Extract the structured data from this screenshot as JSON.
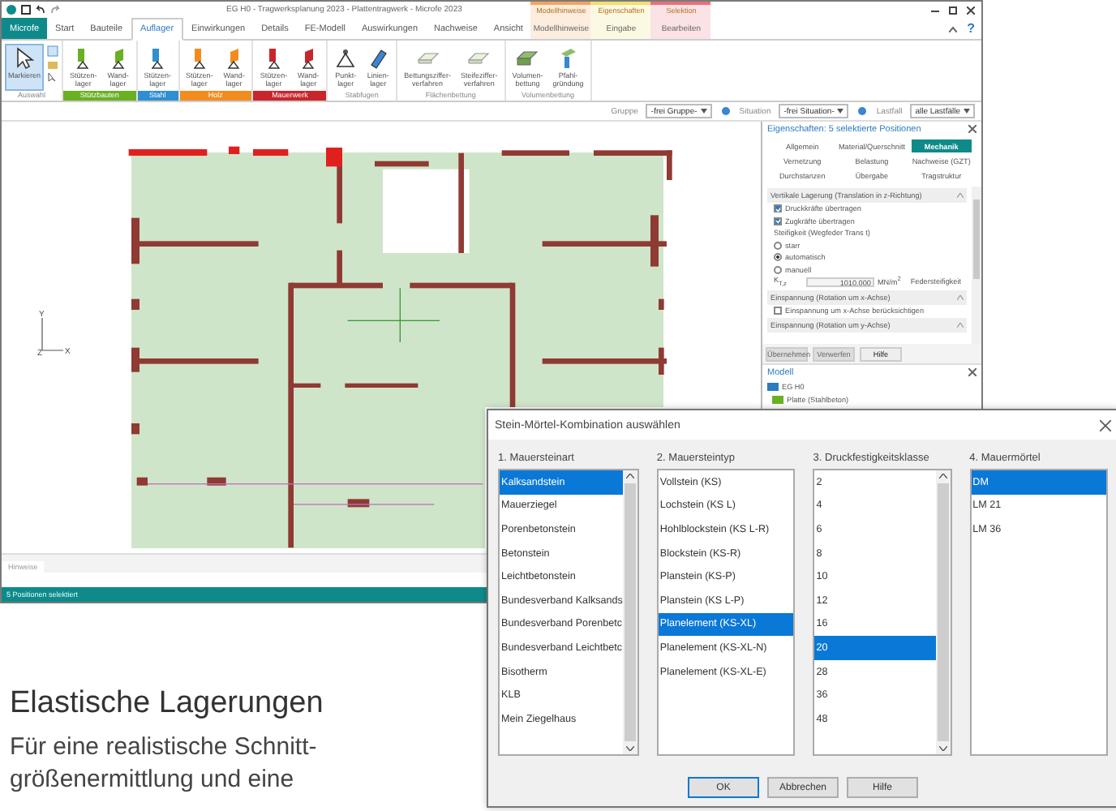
{
  "window": {
    "title": "EG H0 - Tragwerksplanung 2023 - Plattentragwerk - Microfe 2023"
  },
  "ribbon_tabs": [
    {
      "label": "Microfe",
      "kind": "app",
      "selected": false
    },
    {
      "label": "Start",
      "kind": "tab",
      "selected": false
    },
    {
      "label": "Bauteile",
      "kind": "tab",
      "selected": false
    },
    {
      "label": "Auflager",
      "kind": "tab",
      "selected": true
    },
    {
      "label": "Einwirkungen",
      "kind": "tab",
      "selected": false
    },
    {
      "label": "Details",
      "kind": "tab",
      "selected": false
    },
    {
      "label": "FE-Modell",
      "kind": "tab",
      "selected": false
    },
    {
      "label": "Auswirkungen",
      "kind": "tab",
      "selected": false
    },
    {
      "label": "Nachweise",
      "kind": "tab",
      "selected": false
    },
    {
      "label": "Ansicht",
      "kind": "tab",
      "selected": false
    }
  ],
  "context_tabs": [
    {
      "group": "Modellhinweise",
      "label": "Modellhinweise",
      "color": "#f4a460"
    },
    {
      "group": "Eigenschaften",
      "label": "Eingabe",
      "color": "#f2df6e"
    },
    {
      "group": "Selektion",
      "label": "Bearbeiten",
      "color": "#e8707c"
    }
  ],
  "help": "?",
  "ribbon_groups": [
    {
      "label": "Auswahl",
      "buttons": [
        {
          "label": "Markieren",
          "kind": "pointer",
          "selected": true
        }
      ]
    },
    {
      "label": "Stützbauten",
      "color": "#6ab023",
      "buttons": [
        {
          "label": "Stützen-\nlager",
          "kind": "column",
          "selected": false
        },
        {
          "label": "Wand-\nlager",
          "kind": "wall",
          "selected": false
        }
      ]
    },
    {
      "label": "Stahl",
      "color": "#2f8fd0",
      "buttons": [
        {
          "label": "Stützen-\nlager",
          "kind": "column",
          "selected": false
        }
      ]
    },
    {
      "label": "Holz",
      "color": "#f28c1e",
      "buttons": [
        {
          "label": "Stützen-\nlager",
          "kind": "column",
          "selected": false
        },
        {
          "label": "Wand-\nlager",
          "kind": "wall",
          "selected": false
        }
      ]
    },
    {
      "label": "Mauerwerk",
      "color": "#c8262c",
      "buttons": [
        {
          "label": "Stützen-\nlager",
          "kind": "column",
          "selected": false
        },
        {
          "label": "Wand-\nlager",
          "kind": "wall",
          "selected": false
        }
      ]
    },
    {
      "label": "Stabfugen",
      "buttons": [
        {
          "label": "Punkt-\nlager",
          "kind": "point",
          "selected": false
        },
        {
          "label": "Linien-\nlager",
          "kind": "line",
          "selected": false
        }
      ]
    },
    {
      "label": "Flächenbettung",
      "buttons": [
        {
          "label": "Bettungsziffer-\nverfahren",
          "kind": "plate",
          "selected": false
        },
        {
          "label": "Steifeziffer-\nverfahren",
          "kind": "plate",
          "selected": false
        }
      ]
    },
    {
      "label": "Volumenbettung",
      "buttons": [
        {
          "label": "Volumen-\nbettung",
          "kind": "volume",
          "selected": false
        },
        {
          "label": "Pfahl-\ngründung",
          "kind": "pile",
          "selected": false
        }
      ]
    }
  ],
  "filters": [
    {
      "label": "Gruppe",
      "value": "-frei Gruppe-"
    },
    {
      "label": "Situation",
      "value": "-frei Situation-"
    },
    {
      "label": "Lastfall",
      "value": "alle Lastfälle"
    }
  ],
  "canvas": {
    "axis": {
      "y": "Y",
      "z": "Z",
      "x": "X"
    },
    "hint_tab": "Hinweise"
  },
  "status_bar": "5 Positionen selektiert",
  "properties": {
    "title": "Eigenschaften: 5 selektierte Positionen",
    "tabs": [
      {
        "label": "Allgemein",
        "selected": false
      },
      {
        "label": "Material/Querschnitt",
        "selected": false
      },
      {
        "label": "Mechanik",
        "selected": true
      },
      {
        "label": "Vernetzung",
        "selected": false
      },
      {
        "label": "Belastung",
        "selected": false
      },
      {
        "label": "Nachweise (GZT)",
        "selected": false
      },
      {
        "label": "Durchstanzen",
        "selected": false
      },
      {
        "label": "Übergabe",
        "selected": false
      },
      {
        "label": "Tragstruktur",
        "selected": false
      }
    ],
    "sections": [
      {
        "title": "Vertikale Lagerung (Translation in z-Richtung)",
        "rows": [
          {
            "kind": "checkbox",
            "label": "Druckkräfte übertragen",
            "checked": true
          },
          {
            "kind": "checkbox",
            "label": "Zugkräfte übertragen",
            "checked": true
          },
          {
            "kind": "text",
            "label": "Steifigkeit (Wegfeder Trans t)"
          },
          {
            "kind": "radio",
            "label": "starr",
            "selected": false
          },
          {
            "kind": "radio",
            "label": "automatisch",
            "selected": true
          },
          {
            "kind": "radio",
            "label": "manuell",
            "selected": false
          },
          {
            "kind": "field",
            "label": "K$_{T,z}$",
            "value": "1010.000",
            "unit": "MN/m$^{2}$",
            "note": "Federsteifigkeit"
          }
        ]
      },
      {
        "title": "Einspannung (Rotation um x-Achse)",
        "rows": [
          {
            "kind": "checkbox",
            "label": "Einspannung um x-Achse berücksichtigen",
            "checked": false
          }
        ]
      },
      {
        "title": "Einspannung (Rotation um y-Achse)"
      }
    ],
    "buttons": [
      {
        "label": "Übernehmen",
        "disabled": true
      },
      {
        "label": "Verwerfen",
        "disabled": true
      },
      {
        "label": "Hilfe",
        "disabled": false
      }
    ]
  },
  "model": {
    "title": "Modell",
    "tree": [
      {
        "label": "EG H0",
        "children": [
          {
            "label": "Platte (Stahlbeton)"
          }
        ]
      }
    ]
  },
  "dialog": {
    "title": "Stein-Mörtel-Kombination auswählen",
    "columns": [
      {
        "label": "1. Mauersteinart",
        "items": [
          {
            "label": "Kalksandstein",
            "selected": true
          },
          {
            "label": "Mauerziegel",
            "selected": false
          },
          {
            "label": "Porenbetonstein",
            "selected": false
          },
          {
            "label": "Betonstein",
            "selected": false
          },
          {
            "label": "Leichtbetonstein",
            "selected": false
          },
          {
            "label": "Bundesverband Kalksands",
            "selected": false
          },
          {
            "label": "Bundesverband Porenbetc",
            "selected": false
          },
          {
            "label": "Bundesverband Leichtbetc",
            "selected": false
          },
          {
            "label": "Bisotherm",
            "selected": false
          },
          {
            "label": "KLB",
            "selected": false
          },
          {
            "label": "Mein Ziegelhaus",
            "selected": false
          }
        ]
      },
      {
        "label": "2. Mauersteintyp",
        "items": [
          {
            "label": "Vollstein (KS)",
            "selected": false
          },
          {
            "label": "Lochstein (KS L)",
            "selected": false
          },
          {
            "label": "Hohlblockstein (KS L-R)",
            "selected": false
          },
          {
            "label": "Blockstein (KS-R)",
            "selected": false
          },
          {
            "label": "Planstein (KS-P)",
            "selected": false
          },
          {
            "label": "Planstein (KS L-P)",
            "selected": false
          },
          {
            "label": "Planelement (KS-XL)",
            "selected": true
          },
          {
            "label": "Planelement (KS-XL-N)",
            "selected": false
          },
          {
            "label": "Planelement (KS-XL-E)",
            "selected": false
          }
        ]
      },
      {
        "label": "3. Druckfestigkeitsklasse",
        "items": [
          {
            "label": "2",
            "selected": false
          },
          {
            "label": "4",
            "selected": false
          },
          {
            "label": "6",
            "selected": false
          },
          {
            "label": "8",
            "selected": false
          },
          {
            "label": "10",
            "selected": false
          },
          {
            "label": "12",
            "selected": false
          },
          {
            "label": "16",
            "selected": false
          },
          {
            "label": "20",
            "selected": true
          },
          {
            "label": "28",
            "selected": false
          },
          {
            "label": "36",
            "selected": false
          },
          {
            "label": "48",
            "selected": false
          }
        ]
      },
      {
        "label": "4. Mauermörtel",
        "items": [
          {
            "label": "DM",
            "selected": true
          },
          {
            "label": "LM 21",
            "selected": false
          },
          {
            "label": "LM 36",
            "selected": false
          }
        ]
      }
    ],
    "buttons": [
      {
        "label": "OK",
        "default": true
      },
      {
        "label": "Abbrechen",
        "default": false
      },
      {
        "label": "Hilfe",
        "default": false
      }
    ]
  },
  "article": {
    "heading": "Elastische Lagerungen",
    "lines": [
      "Für eine realistische Schnitt-",
      "größenermittlung und eine"
    ]
  }
}
